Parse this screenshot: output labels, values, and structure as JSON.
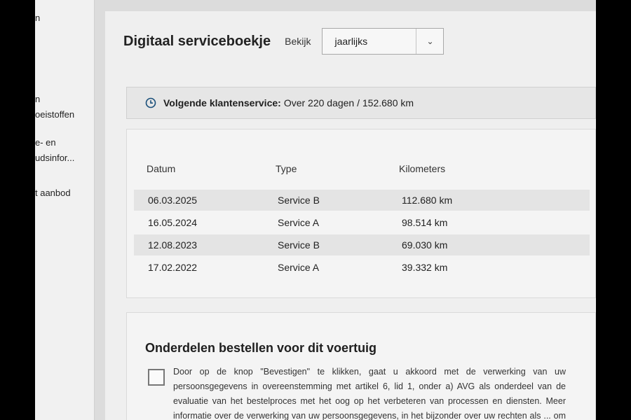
{
  "sidebar": {
    "items": [
      {
        "label": "n"
      },
      {
        "label": "n"
      },
      {
        "label": "oeistoffen"
      },
      {
        "label": "e- en"
      },
      {
        "label": "udsinfor..."
      },
      {
        "label": "t aanbod"
      }
    ]
  },
  "header": {
    "title": "Digitaal serviceboekje",
    "view_label": "Bekijk",
    "view_select": {
      "value": "jaarlijks"
    }
  },
  "next_service": {
    "icon": "clock-icon",
    "label": "Volgende klantenservice:",
    "value": "Over 220 dagen / 152.680 km"
  },
  "history": {
    "columns": [
      "Datum",
      "Type",
      "Kilometers"
    ],
    "rows": [
      {
        "date": "06.03.2025",
        "type": "Service B",
        "km": "112.680 km"
      },
      {
        "date": "16.05.2024",
        "type": "Service A",
        "km": "98.514 km"
      },
      {
        "date": "12.08.2023",
        "type": "Service B",
        "km": "69.030 km"
      },
      {
        "date": "17.02.2022",
        "type": "Service A",
        "km": "39.332 km"
      }
    ]
  },
  "order_parts": {
    "title": "Onderdelen bestellen voor dit voertuig",
    "consent_text": "Door op de knop \"Bevestigen\" te klikken, gaat u akkoord met de verwerking van uw persoonsgegevens in overeenstemming met artikel 6, lid 1, onder a) AVG als onderdeel van de evaluatie van het bestelproces met het oog op het verbeteren van processen en diensten. Meer informatie over de verwerking van uw persoonsgegevens, in het bijzonder over uw rechten als ... om uw toestemming in te trekken, is te vinden in"
  },
  "colors": {
    "page_bg": "#efefef",
    "accent_icon": "#1a4f7a"
  }
}
